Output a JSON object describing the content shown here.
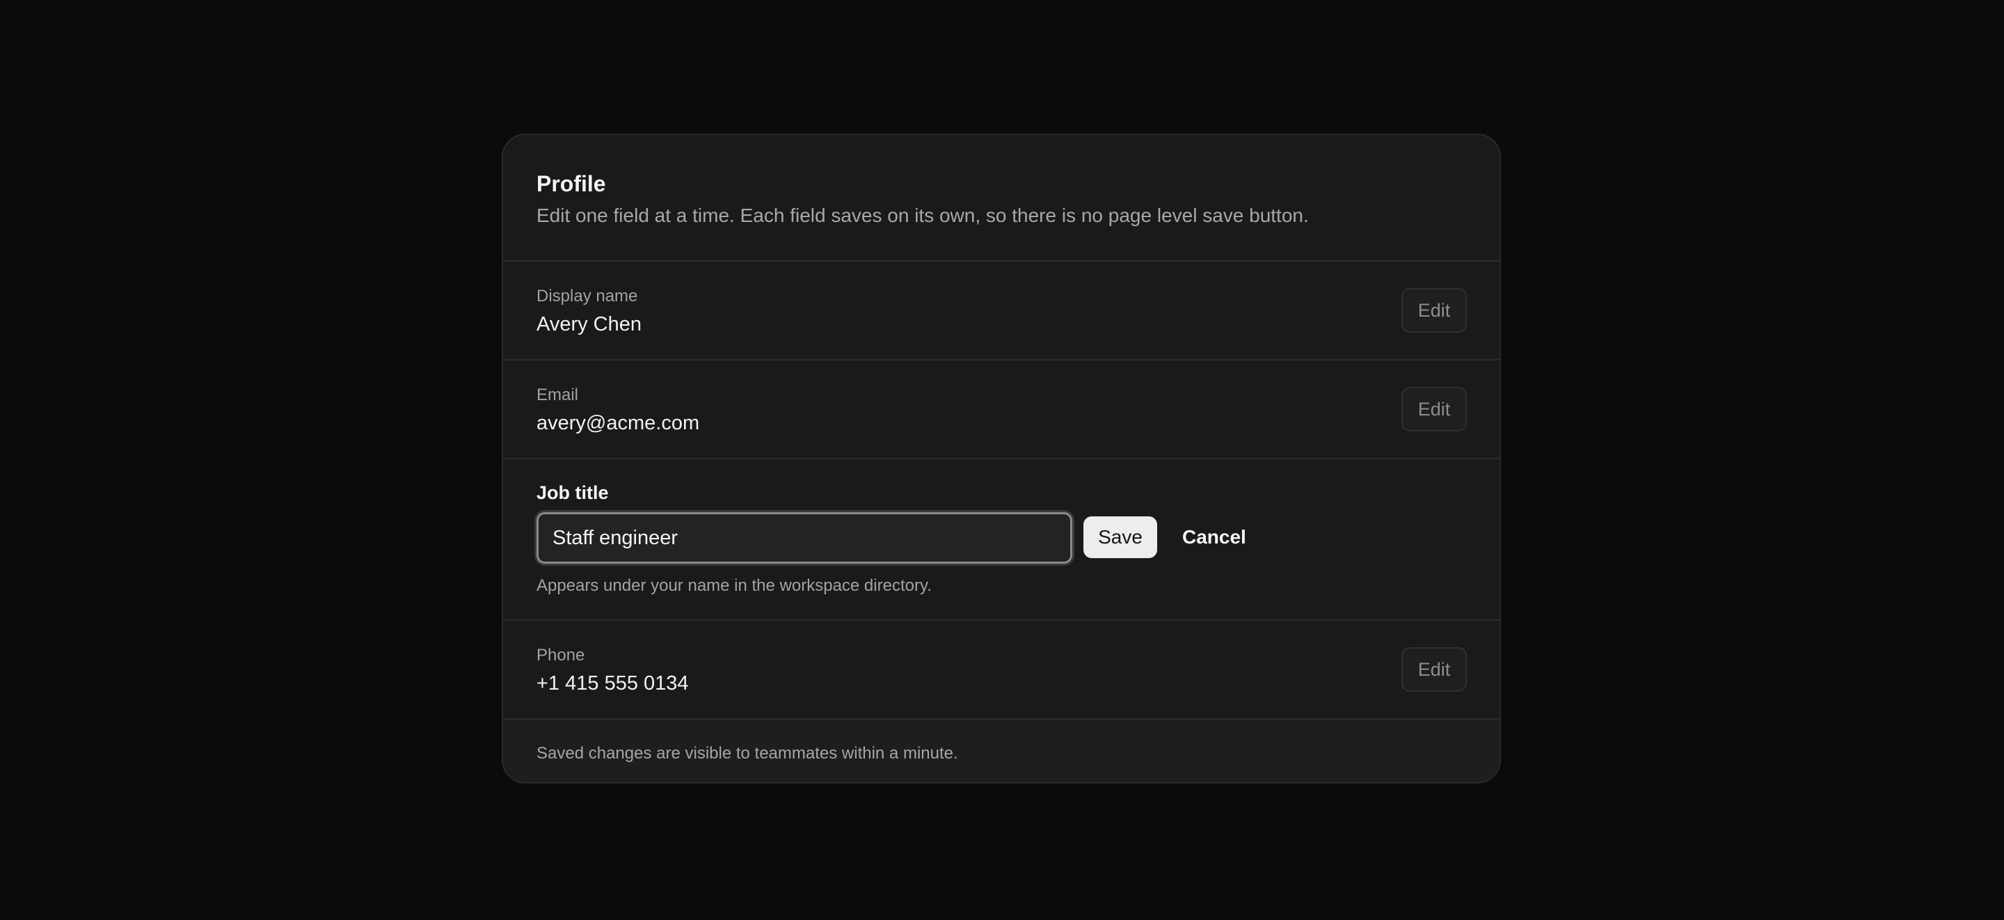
{
  "profile": {
    "title": "Profile",
    "description": "Edit one field at a time. Each field saves on its own, so there is no page level save button.",
    "fields": [
      {
        "label": "Display name",
        "value": "Avery Chen",
        "edit_label": "Edit"
      },
      {
        "label": "Email",
        "value": "avery@acme.com",
        "edit_label": "Edit"
      },
      {
        "label": "Phone",
        "value": "+1 415 555 0134",
        "edit_label": "Edit"
      }
    ],
    "editing_field": {
      "label": "Job title",
      "input_value": "Staff engineer",
      "save_label": "Save",
      "cancel_label": "Cancel",
      "hint": "Appears under your name in the workspace directory."
    },
    "footer": "Saved changes are visible to teammates within a minute."
  }
}
